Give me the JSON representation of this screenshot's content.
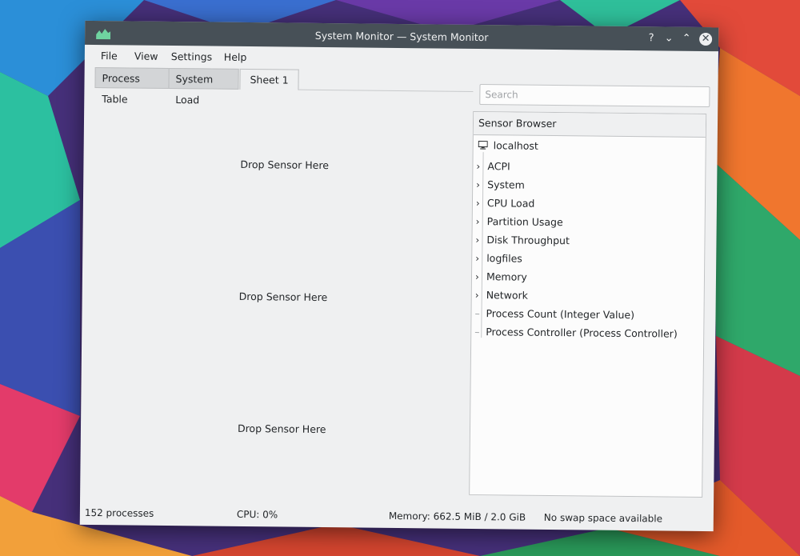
{
  "window": {
    "title": "System Monitor — System Monitor"
  },
  "titlebar_buttons": [
    "?",
    "⌄",
    "⌃",
    "✕"
  ],
  "menu": [
    "File",
    "View",
    "Settings",
    "Help"
  ],
  "tabs": [
    {
      "label": "Process Table",
      "active": false
    },
    {
      "label": "System Load",
      "active": false
    },
    {
      "label": "Sheet 1",
      "active": true
    }
  ],
  "sheet": {
    "drop_labels": [
      "Drop Sensor Here",
      "Drop Sensor Here",
      "Drop Sensor Here"
    ]
  },
  "search": {
    "placeholder": "Search"
  },
  "sensor_browser": {
    "header": "Sensor Browser",
    "root": {
      "label": "localhost",
      "icon": "monitor-icon"
    },
    "items": [
      {
        "label": "ACPI",
        "expandable": true
      },
      {
        "label": "System",
        "expandable": true
      },
      {
        "label": "CPU Load",
        "expandable": true
      },
      {
        "label": "Partition Usage",
        "expandable": true
      },
      {
        "label": "Disk Throughput",
        "expandable": true
      },
      {
        "label": "logfiles",
        "expandable": true
      },
      {
        "label": "Memory",
        "expandable": true
      },
      {
        "label": "Network",
        "expandable": true
      },
      {
        "label": "Process Count (Integer Value)",
        "expandable": false
      },
      {
        "label": "Process Controller (Process Controller)",
        "expandable": false
      }
    ]
  },
  "statusbar": {
    "processes": "152 processes",
    "cpu": "CPU: 0%",
    "memory": "Memory: 662.5 MiB / 2.0 GiB",
    "swap": "No swap space available"
  },
  "colors": {
    "titlebar": "#475057",
    "window_bg": "#eff0f1",
    "view_bg": "#fcfcfc"
  }
}
